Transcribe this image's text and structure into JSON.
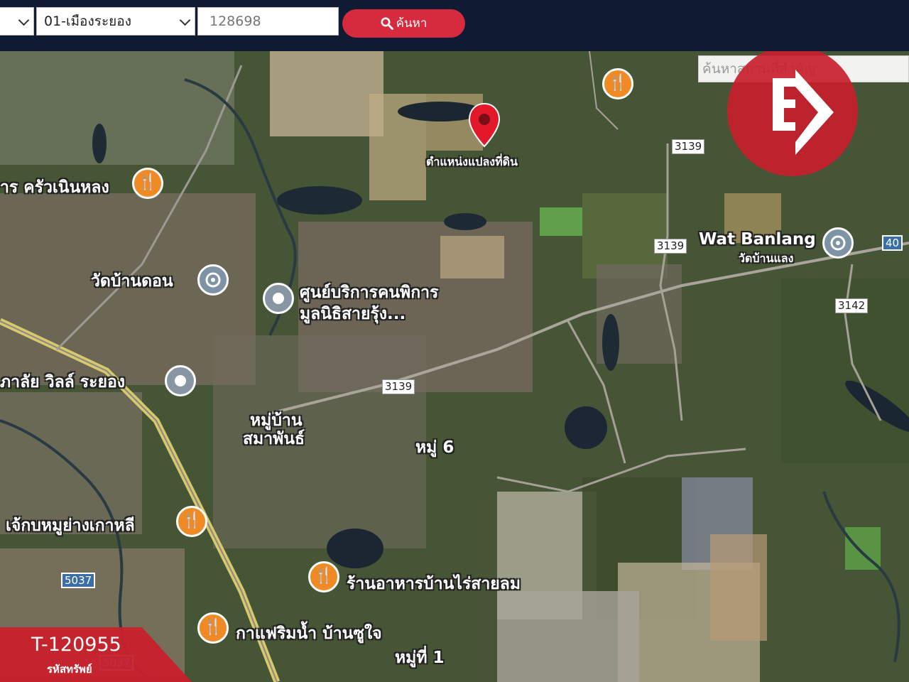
{
  "topbar": {
    "province_value": "",
    "district_value": "01-เมืองระยอง",
    "code_value": "128698",
    "search_button_label": "ค้นหา"
  },
  "map": {
    "search_placeholder": "ค้นหาสถานที่สำคัญ",
    "parcel_label": "ตำแหน่งแปลงที่ดิน",
    "labels": {
      "restaurant_kruawnoenlong": "าร ครัวเนินหลง",
      "wat_ban_don": "วัดบ้านดอน",
      "disability_center_line1": "ศูนย์บริการคนพิการ",
      "disability_center_line2": "มูลนิธิสายรุ้ง...",
      "college_wills": "ภาลัย วิลล์ ระยอง",
      "village_samaphan_line1": "หมู่บ้าน",
      "village_samaphan_line2": "สมาพันธ์",
      "moo6": "หมู่ 6",
      "korean_bbq": "เจ้กบหมูย่างเกาหลี",
      "ban_rai_restaurant": "ร้านอาหารบ้านไร่สายลม",
      "cafe": "กาแฟริมน้ำ บ้านซูใจ",
      "moo1": "หมู่ที่ 1",
      "wat_banlang_en": "Wat Banlang",
      "wat_banlang_th": "วัดบ้านแลง"
    },
    "road_shields": {
      "r3139_a": "3139",
      "r3139_b": "3139",
      "r3139_c": "3139",
      "r3142": "3142",
      "r40": "40",
      "r5037_a": "5037",
      "r5037_b": "5037"
    }
  },
  "badge": {
    "asset_code": "T-120955",
    "asset_label": "รหัสทรัพย์"
  },
  "colors": {
    "topbar_bg": "#0f1a33",
    "search_button": "#d62a3e",
    "logo_red": "#c8202c",
    "food_poi": "#f08a24",
    "parcel_pin": "#e3192b"
  }
}
